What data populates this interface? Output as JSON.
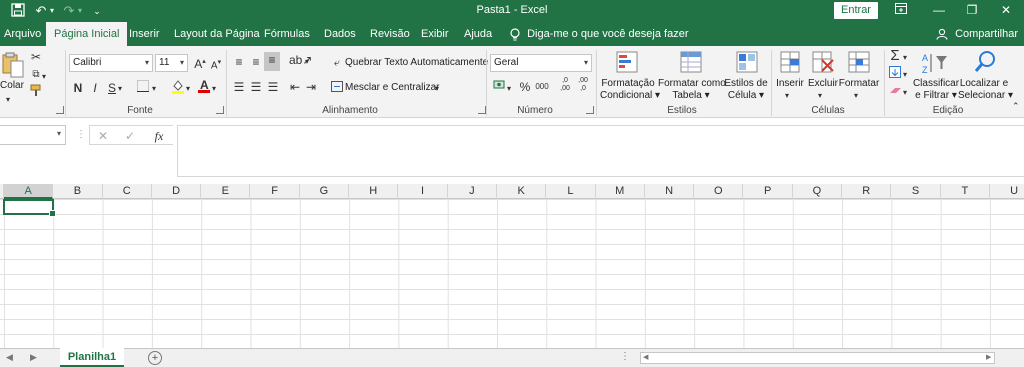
{
  "window": {
    "title": "Pasta1  -  Excel",
    "signin_label": "Entrar",
    "quick_access": {
      "save_icon": "save-icon",
      "undo_icon": "undo-icon",
      "redo_icon": "redo-icon",
      "customize_icon": "customize-icon"
    },
    "controls": {
      "ribbon_options_icon": "ribbon-display-icon",
      "minimize": "—",
      "restore": "❐",
      "close": "✕"
    }
  },
  "tabs": [
    {
      "label": "Arquivo"
    },
    {
      "label": "Página Inicial",
      "active": true
    },
    {
      "label": "Inserir"
    },
    {
      "label": "Layout da Página"
    },
    {
      "label": "Fórmulas"
    },
    {
      "label": "Dados"
    },
    {
      "label": "Revisão"
    },
    {
      "label": "Exibir"
    },
    {
      "label": "Ajuda"
    }
  ],
  "tell_me": "Diga-me o que você deseja fazer",
  "share": "Compartilhar",
  "ribbon": {
    "clipboard": {
      "paste_label": "Colar",
      "icons": [
        "cut-icon",
        "copy-icon",
        "format-painter-icon"
      ]
    },
    "font": {
      "group_label": "Fonte",
      "font_name": "Calibri",
      "font_size": "11",
      "grow": "A",
      "shrink": "A",
      "bold": "N",
      "italic": "I",
      "underline": "S"
    },
    "alignment": {
      "group_label": "Alinhamento",
      "wrap_text": "Quebrar Texto Automaticamente",
      "merge_center": "Mesclar e Centralizar"
    },
    "number": {
      "group_label": "Número",
      "format": "Geral",
      "percent": "%",
      "thousands": "000",
      "inc_decimal": ",0 ,00",
      "dec_decimal": ",00 ,0"
    },
    "styles": {
      "group_label": "Estilos",
      "conditional": [
        "Formatação",
        "Condicional"
      ],
      "format_table": [
        "Formatar como",
        "Tabela"
      ],
      "cell_styles": [
        "Estilos de",
        "Célula"
      ]
    },
    "cells": {
      "group_label": "Células",
      "insert": "Inserir",
      "delete": "Excluir",
      "format": "Formatar"
    },
    "editing": {
      "group_label": "Edição",
      "sort_filter": [
        "Classificar",
        "e Filtrar"
      ],
      "find_select": [
        "Localizar e",
        "Selecionar"
      ]
    }
  },
  "formula_bar": {
    "cancel": "✕",
    "enter": "✓",
    "fx": "fx"
  },
  "columns": [
    "A",
    "B",
    "C",
    "D",
    "E",
    "F",
    "G",
    "H",
    "I",
    "J",
    "K",
    "L",
    "M",
    "N",
    "O",
    "P",
    "Q",
    "R",
    "S",
    "T",
    "U"
  ],
  "selected_column": "A",
  "sheet": {
    "tab": "Planilha1",
    "add": "+"
  },
  "colors": {
    "brand": "#217346"
  }
}
